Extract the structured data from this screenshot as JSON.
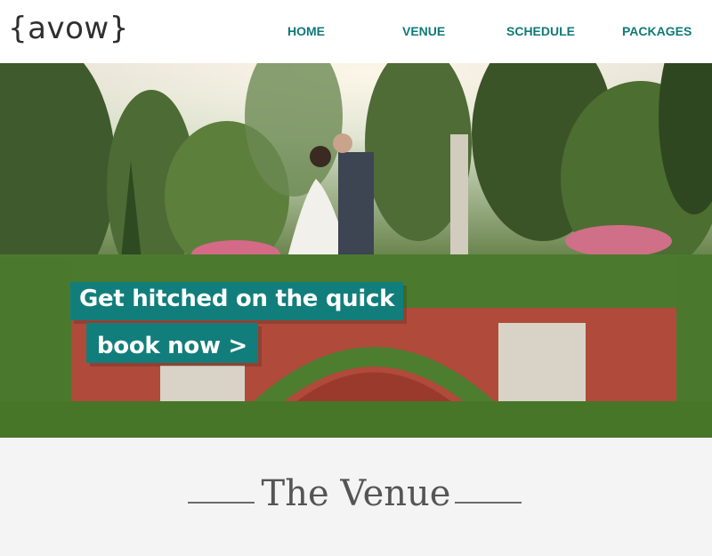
{
  "header": {
    "logo": "{avow}",
    "nav": [
      {
        "label": "HOME"
      },
      {
        "label": "VENUE"
      },
      {
        "label": "SCHEDULE"
      },
      {
        "label": "PACKAGES"
      }
    ]
  },
  "hero": {
    "headline": "Get hitched on the quick",
    "button_label": "book now >"
  },
  "venue": {
    "title": "The Venue"
  },
  "colors": {
    "accent": "#127e7c",
    "nav_text": "#0f7a78",
    "logo_text": "#2f2f2f",
    "section_bg": "#f4f4f4"
  }
}
